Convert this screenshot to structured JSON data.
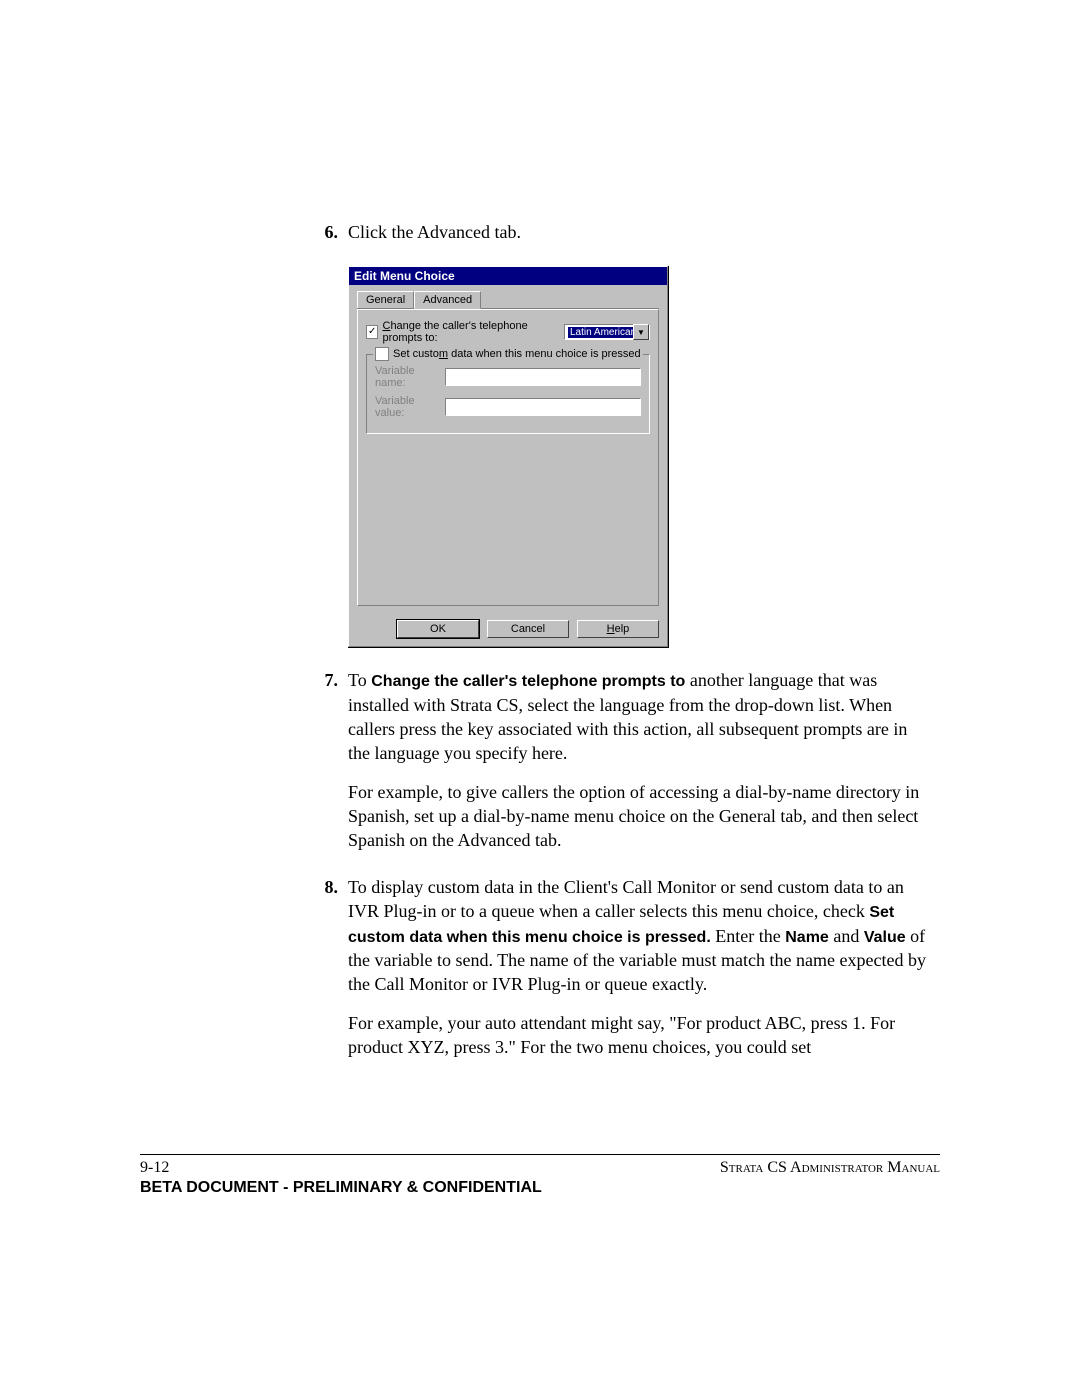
{
  "steps": {
    "6": {
      "num": "6.",
      "text": "Click the Advanced tab."
    },
    "7": {
      "num": "7.",
      "lead": "To ",
      "bold1": "Change the caller's telephone prompts to",
      "tail1": " another language that was installed with Strata CS, select the language from the drop-down list. When callers press the key associated with this action, all subsequent prompts are in the language you specify here.",
      "p2": "For example, to give callers the option of accessing a dial-by-name directory in Spanish, set up a dial-by-name menu choice on the General tab, and then select Spanish on the Advanced tab."
    },
    "8": {
      "num": "8.",
      "p1a": "To display custom data in the Client's Call Monitor or send custom data to an IVR Plug-in or to a queue when a caller selects this menu choice, check ",
      "bold1": "Set custom data when this menu choice is pressed.",
      "p1b": " Enter the ",
      "bold2": "Name",
      "p1c": " and ",
      "bold3": "Value",
      "p1d": " of the variable to send. The name of the variable must match the name expected by the Call Monitor or IVR Plug-in or queue exactly.",
      "p2": "For example, your auto attendant might say, \"For product ABC, press 1. For product XYZ, press 3.\" For the two menu choices, you could set"
    }
  },
  "dialog": {
    "title": "Edit Menu Choice",
    "tabs": {
      "general": "General",
      "advanced": "Advanced"
    },
    "change_prefix": "C",
    "change_rest": "hange the caller's telephone prompts to:",
    "language": "Latin American S",
    "group_prefix": "Set custo",
    "group_ul": "m",
    "group_rest": " data when this menu choice is pressed",
    "varname_pre": "Varia",
    "varname_ul": "b",
    "varname_post": "le name:",
    "varvalue_pre": "Variable val",
    "varvalue_ul": "u",
    "varvalue_post": "e:",
    "ok": "OK",
    "cancel": "Cancel",
    "help_ul": "H",
    "help_rest": "elp"
  },
  "footer": {
    "page": "9-12",
    "manual": "Strata CS Administrator Manual",
    "confidential": "BETA DOCUMENT - PRELIMINARY & CONFIDENTIAL"
  }
}
